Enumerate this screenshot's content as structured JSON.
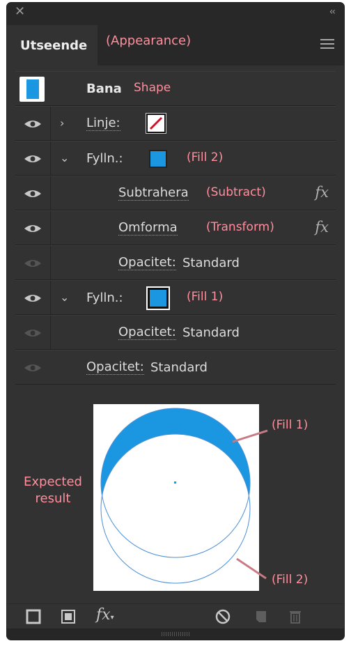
{
  "panel": {
    "tab_label": "Utseende",
    "tab_annotation": "(Appearance)"
  },
  "rows": [
    {
      "label": "Bana",
      "annotation": "Shape"
    },
    {
      "label": "Linje:"
    },
    {
      "label": "Fylln.:",
      "annotation": "(Fill 2)"
    },
    {
      "label": "Subtrahera",
      "annotation": "(Subtract)"
    },
    {
      "label": "Omforma",
      "annotation": "(Transform)"
    },
    {
      "label": "Opacitet:",
      "value": "Standard"
    },
    {
      "label": "Fylln.:",
      "annotation": "(Fill 1)"
    },
    {
      "label": "Opacitet:",
      "value": "Standard"
    },
    {
      "label": "Opacitet:",
      "value": "Standard"
    }
  ],
  "fx_label": "fx",
  "preview": {
    "expected_line1": "Expected",
    "expected_line2": "result",
    "fill1_label": "(Fill 1)",
    "fill2_label": "(Fill 2)"
  },
  "colors": {
    "accent_fill": "#1a97e0",
    "annotation": "#ff8f9e",
    "panel_bg": "#323232"
  }
}
